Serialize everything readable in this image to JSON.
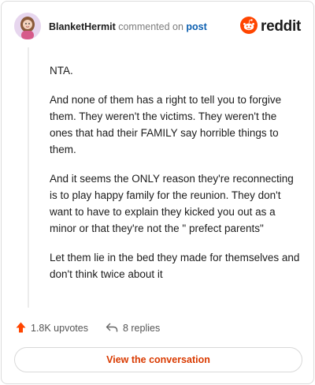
{
  "comment": {
    "author": "BlanketHermit",
    "commented_text": "commented on",
    "post_link": "post",
    "paragraphs": [
      "NTA.",
      "And none of them has a right to tell you to forgive them. They weren't the victims. They weren't the ones that had their FAMILY say horrible things to them.",
      "And it seems the ONLY reason they're reconnecting is to play happy family for the reunion. They don't want to have to explain they kicked you out as a minor or that they're not the \" prefect parents\"",
      "Let them lie in the bed they made for themselves and don't think twice about it"
    ]
  },
  "brand": {
    "wordmark": "reddit",
    "color": "#ff4500",
    "icon": "reddit-snoo-icon"
  },
  "actions": {
    "upvotes": "1.8K upvotes",
    "replies": "8 replies",
    "upvote_icon": "upvote-arrow-icon",
    "reply_icon": "reply-arrow-icon",
    "upvote_color": "#ff4500"
  },
  "view_button": {
    "label": "View the conversation",
    "color": "#d93a00"
  }
}
